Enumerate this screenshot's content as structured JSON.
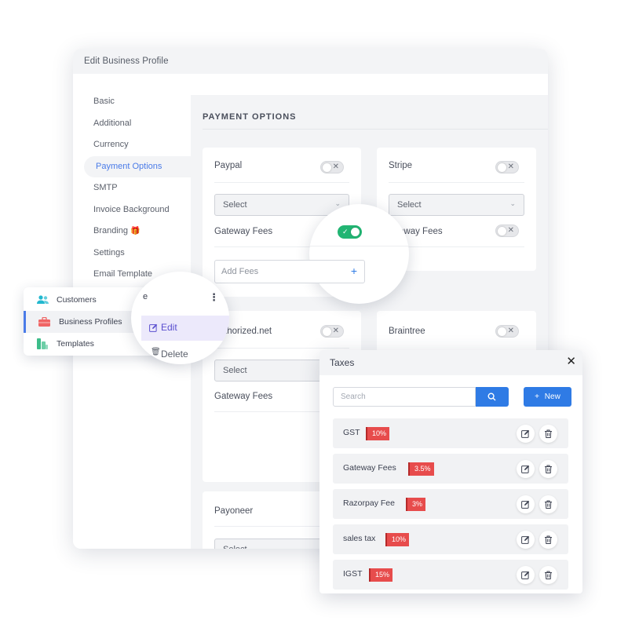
{
  "window": {
    "title": "Edit Business Profile"
  },
  "sidebar": {
    "items": [
      {
        "label": "Basic"
      },
      {
        "label": "Additional"
      },
      {
        "label": "Currency"
      },
      {
        "label": "Payment Options",
        "active": true
      },
      {
        "label": "SMTP"
      },
      {
        "label": "Invoice Background"
      },
      {
        "label": "Branding",
        "icon": "gift-icon"
      },
      {
        "label": "Settings"
      },
      {
        "label": "Email Template"
      }
    ]
  },
  "payment": {
    "section_title": "PAYMENT OPTIONS",
    "gateways": [
      {
        "name": "Paypal",
        "enabled": false
      },
      {
        "name": "Stripe",
        "enabled": false
      },
      {
        "name": "Authorized.net",
        "visible_name": "thorized.net",
        "enabled": false
      },
      {
        "name": "Braintree",
        "enabled": false
      },
      {
        "name": "Payoneer"
      }
    ],
    "select_placeholder": "Select",
    "gateway_fees_label": "Gateway Fees",
    "gateway_fees_partial": "eway Fees",
    "add_fees_placeholder": "Add Fees",
    "add_icon": "+"
  },
  "customers_menu": {
    "items": [
      {
        "label": "Customers",
        "icon": "users-icon"
      },
      {
        "label": "Business Profiles",
        "icon": "briefcase-icon",
        "active": true
      },
      {
        "label": "Templates",
        "icon": "templates-icon"
      }
    ],
    "partial_text": "e",
    "more_icon": "⋮",
    "edit_label": "Edit",
    "delete_label": "Delete"
  },
  "taxes": {
    "title": "Taxes",
    "close": "✕",
    "search_placeholder": "Search",
    "new_label": "New",
    "new_icon": "+",
    "items": [
      {
        "name": "GST",
        "rate": "10%"
      },
      {
        "name": "Gateway Fees",
        "rate": "3.5%"
      },
      {
        "name": "Razorpay Fee",
        "rate": "3%"
      },
      {
        "name": "sales tax",
        "rate": "10%"
      },
      {
        "name": "IGST",
        "rate": "15%"
      }
    ]
  },
  "colors": {
    "accent": "#2f7be5",
    "active_text": "#4a7be8",
    "toggle_on": "#22b573",
    "badge": "#e74c4c"
  }
}
